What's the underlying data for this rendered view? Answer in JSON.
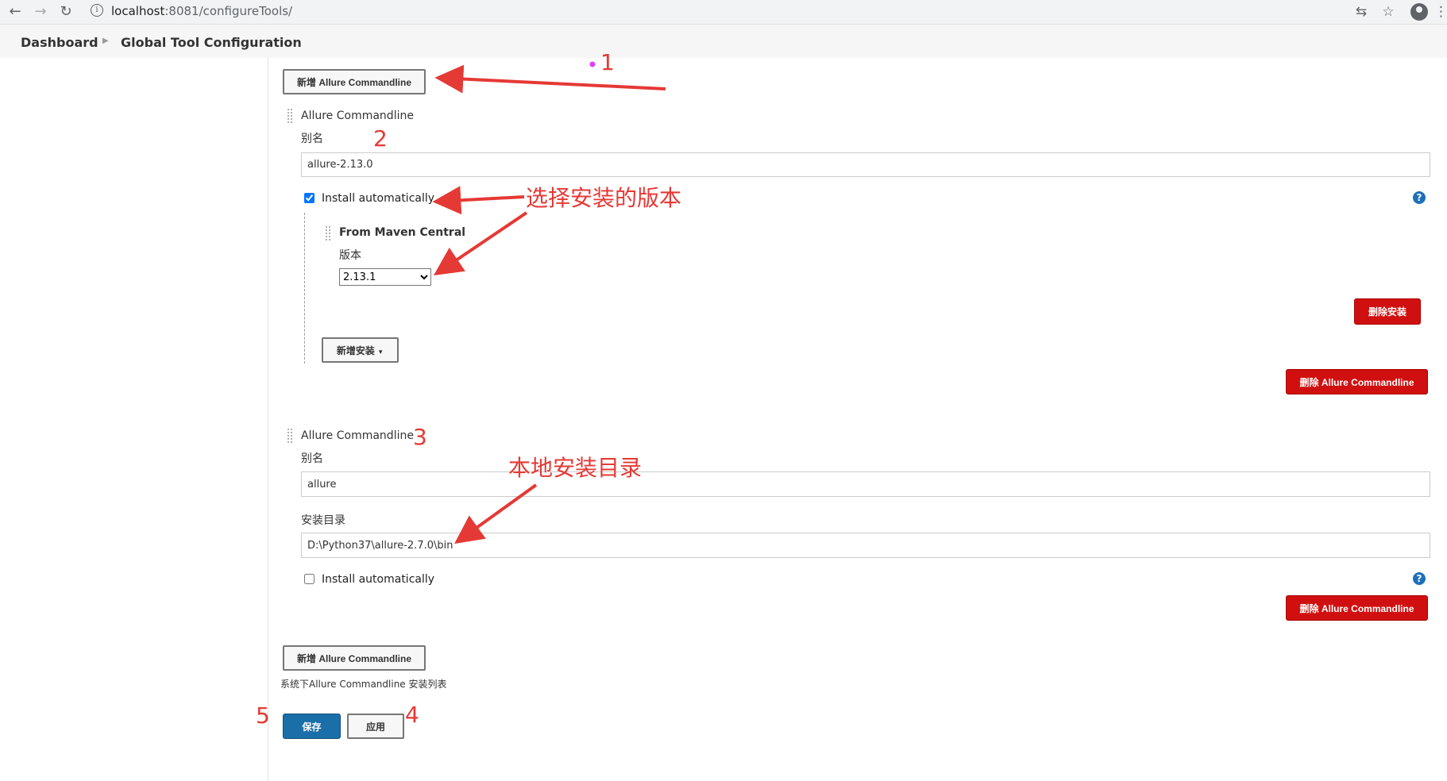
{
  "browser": {
    "url_host": "localhost",
    "url_rest": ":8081/configureTools/",
    "back_icon": "←",
    "forward_icon": "→",
    "reload_icon": "↻"
  },
  "breadcrumb": {
    "dashboard": "Dashboard",
    "current": "Global Tool Configuration"
  },
  "add_button_label": "新增 Allure Commandline",
  "installations": [
    {
      "title": "Allure Commandline",
      "alias_label": "别名",
      "alias_value": "allure-2.13.0",
      "install_auto_label": "Install automatically",
      "install_auto_checked": true,
      "installer": {
        "title": "From Maven Central",
        "version_label": "版本",
        "version_value": "2.13.1",
        "delete_installer_label": "删除安装",
        "add_installer_label": "新增安装"
      },
      "delete_label": "删除 Allure Commandline"
    },
    {
      "title": "Allure Commandline",
      "alias_label": "别名",
      "alias_value": "allure",
      "home_label": "安装目录",
      "home_value": "D:\\Python37\\allure-2.7.0\\bin",
      "install_auto_label": "Install automatically",
      "install_auto_checked": false,
      "delete_label": "删除 Allure Commandline"
    }
  ],
  "list_description": "系统下Allure Commandline 安装列表",
  "save_label": "保存",
  "apply_label": "应用",
  "annotations": {
    "n1": "1",
    "n2": "2",
    "n3": "3",
    "n4": "4",
    "n5": "5",
    "select_version": "选择安装的版本",
    "local_dir": "本地安装目录"
  },
  "colors": {
    "annotation": "#e53935",
    "delete_button": "#d01010",
    "save_button": "#1a6fa8",
    "help_icon": "#1d6fb8"
  }
}
